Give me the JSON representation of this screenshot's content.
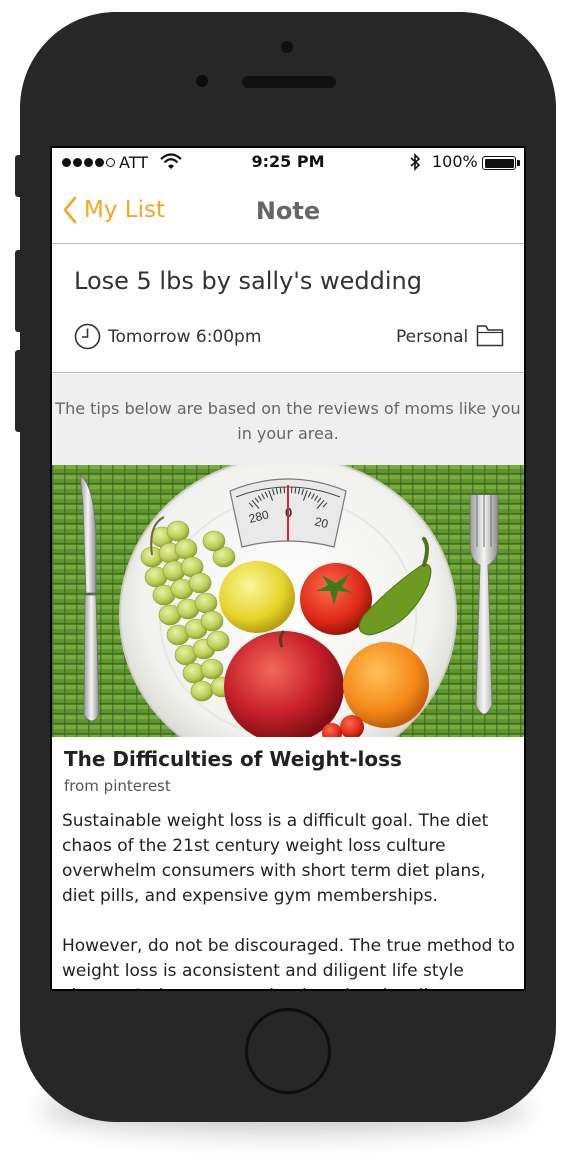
{
  "status_bar": {
    "carrier": "ATT",
    "time": "9:25 PM",
    "battery_percent": "100%",
    "signal_bars_filled": 4,
    "signal_bars_total": 5
  },
  "nav": {
    "back_label": "My List",
    "title": "Note",
    "accent_color": "#f5a623"
  },
  "task": {
    "title": "Lose 5 lbs by sally's wedding",
    "due": "Tomorrow 6:00pm",
    "category": "Personal"
  },
  "tips_banner": "The tips below are based on the reviews of moms like you in your area.",
  "article": {
    "image_scale_labels": [
      "280",
      "0",
      "20"
    ],
    "title": "The Difficulties of Weight-loss",
    "source": "from pinterest",
    "paragraphs": [
      "Sustainable weight loss is a difficult goal. The diet chaos of the 21st century weight loss culture overwhelm consumers with short term diet plans, diet pills, and expensive gym memberships.",
      "However, do not be discouraged. The true method to weight loss is aconsistent and diligent life style change. It does not need to be adrastic adjustment, but a"
    ]
  },
  "icons": {
    "back": "chevron-left-icon",
    "clock": "clock-icon",
    "folder": "folder-icon",
    "wifi": "wifi-icon",
    "bluetooth": "bluetooth-icon",
    "battery": "battery-icon"
  }
}
